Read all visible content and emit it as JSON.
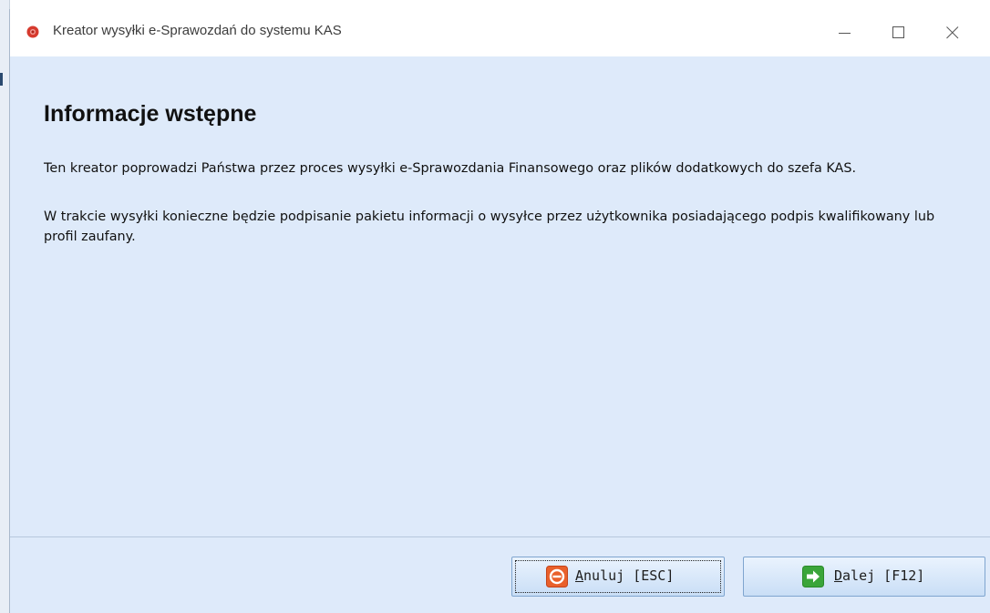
{
  "window": {
    "title": "Kreator wysyłki e-Sprawozdań do systemu KAS"
  },
  "page": {
    "heading": "Informacje wstępne",
    "paragraphs": [
      "Ten kreator poprowadzi Państwa przez proces wysyłki e-Sprawozdania Finansowego oraz plików dodatkowych do szefa KAS.",
      "W trakcie wysyłki konieczne będzie podpisanie pakietu informacji o wysyłce przez użytkownika posiadającego podpis kwalifikowany lub profil zaufany."
    ]
  },
  "buttons": {
    "cancel": {
      "accel": "A",
      "rest": "nuluj [ESC]",
      "icon": "cancel-icon",
      "color": "#e9602b"
    },
    "next": {
      "accel": "D",
      "rest": "alej [F12]",
      "icon": "arrow-right-icon",
      "color": "#3aa53a"
    }
  },
  "colors": {
    "content_bg": "#deeafa",
    "app_icon": "#d63a2e"
  }
}
